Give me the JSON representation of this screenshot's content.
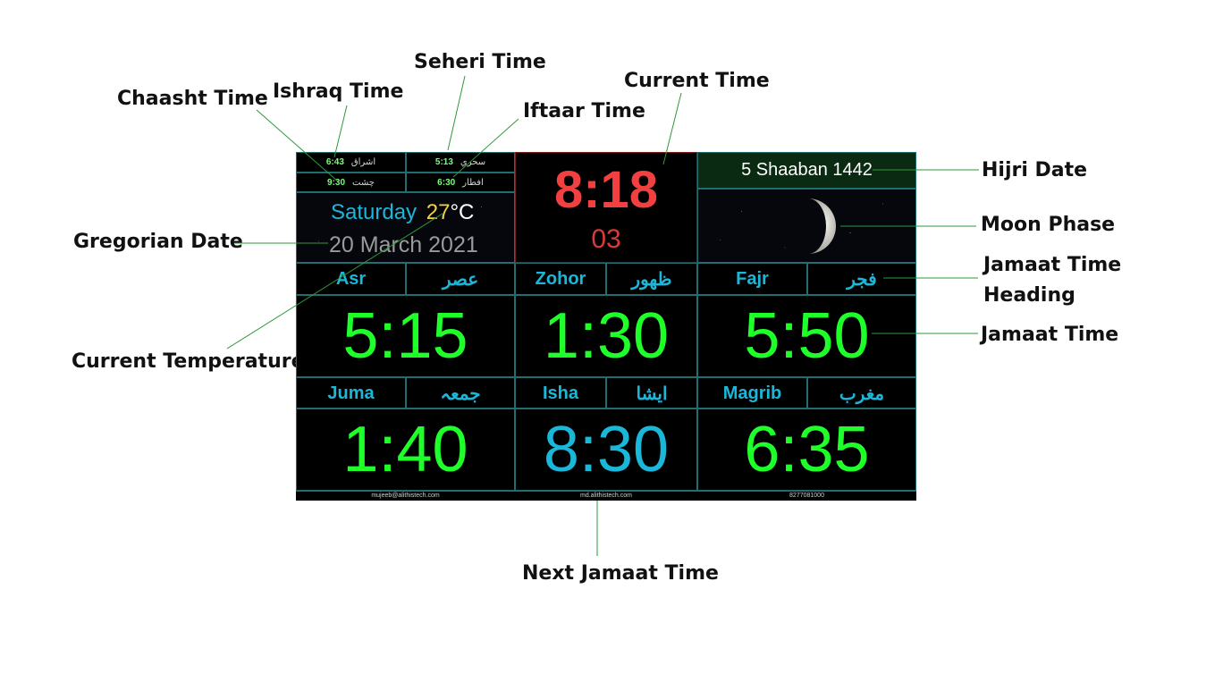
{
  "callouts": {
    "chaasht": "Chaasht Time",
    "ishraq": "Ishraq Time",
    "seheri": "Seheri Time",
    "current_time": "Current Time",
    "iftaar": "Iftaar Time",
    "hijri": "Hijri Date",
    "moon": "Moon Phase",
    "gregorian": "Gregorian Date",
    "jamaat_heading_1": "Jamaat Time",
    "jamaat_heading_2": "Heading",
    "jamaat_time": "Jamaat Time",
    "temperature": "Current Temperature",
    "next_jamaat": "Next Jamaat Time"
  },
  "top_left": {
    "ishraq_time": "6:43",
    "ishraq_label": "اشراق",
    "seheri_time": "5:13",
    "seheri_label": "سحري",
    "chaasht_time": "9:30",
    "chaasht_label": "چشت",
    "iftaar_time": "6:30",
    "iftaar_label": "افطار",
    "day": "Saturday",
    "temp_value": "27",
    "temp_unit": "°C",
    "gregorian_date": "20 March 2021"
  },
  "clock": {
    "time": "8:18",
    "seconds": "03"
  },
  "hijri_date": "5 Shaaban 1442",
  "prayers": [
    {
      "name": "Asr",
      "urdu": "عصر",
      "time": "5:15"
    },
    {
      "name": "Zohor",
      "urdu": "ظهور",
      "time": "1:30"
    },
    {
      "name": "Fajr",
      "urdu": "فجر",
      "time": "5:50"
    },
    {
      "name": "Juma",
      "urdu": "جمعہ",
      "time": "1:40"
    },
    {
      "name": "Isha",
      "urdu": "ایشا",
      "time": "8:30"
    },
    {
      "name": "Magrib",
      "urdu": "مغرب",
      "time": "6:35"
    }
  ],
  "footer": {
    "email": "mujeeb@alithistech.com",
    "site": "md.alithistech.com",
    "phone": "8277081000"
  },
  "colors": {
    "jamaat": "#1fff2a",
    "next_jamaat": "#1bb7d8",
    "clock": "#f04040",
    "heading": "#1bb7d8"
  }
}
